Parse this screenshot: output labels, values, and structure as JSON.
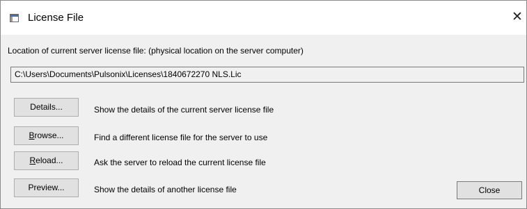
{
  "window": {
    "title": "License File",
    "close_glyph": "✕"
  },
  "location_label": "Location of current server license file:  (physical location on the server computer)",
  "license_path": "C:\\Users\\Documents\\Pulsonix\\Licenses\\1840672270 NLS.Lic",
  "actions": [
    {
      "label_first": "",
      "label_rest": "Details...",
      "description": "Show the details of the current server license file"
    },
    {
      "label_first": "B",
      "label_rest": "rowse...",
      "description": "Find a different license file for the server to use"
    },
    {
      "label_first": "R",
      "label_rest": "eload...",
      "description": "Ask the server to reload the current license file"
    },
    {
      "label_first": "",
      "label_rest": "Preview...",
      "description": "Show the details of another license file"
    }
  ],
  "close_button": "Close",
  "icons": {
    "app": "window-icon",
    "close": "close-icon"
  }
}
